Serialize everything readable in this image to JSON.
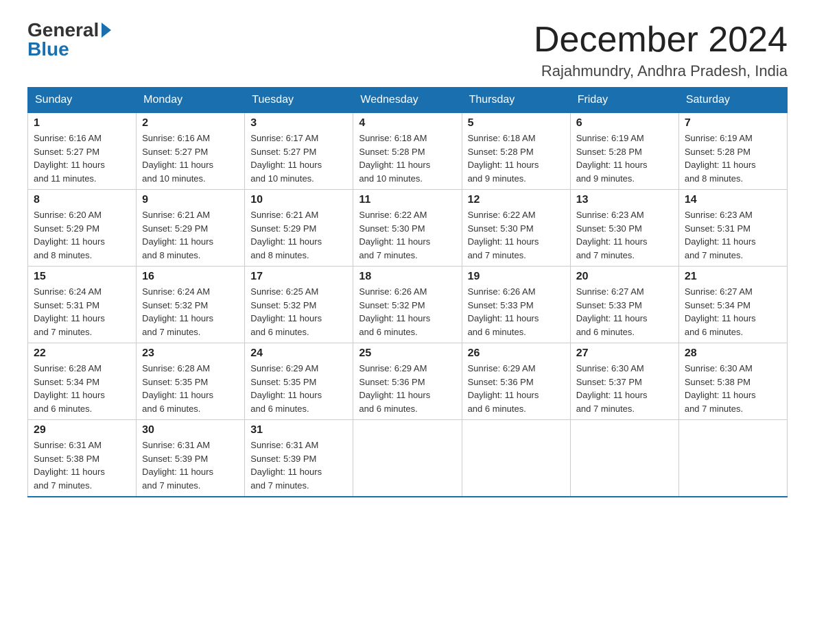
{
  "header": {
    "logo_general": "General",
    "logo_blue": "Blue",
    "title": "December 2024",
    "location": "Rajahmundry, Andhra Pradesh, India"
  },
  "days_of_week": [
    "Sunday",
    "Monday",
    "Tuesday",
    "Wednesday",
    "Thursday",
    "Friday",
    "Saturday"
  ],
  "weeks": [
    [
      {
        "day": "1",
        "sunrise": "6:16 AM",
        "sunset": "5:27 PM",
        "daylight": "11 hours and 11 minutes."
      },
      {
        "day": "2",
        "sunrise": "6:16 AM",
        "sunset": "5:27 PM",
        "daylight": "11 hours and 10 minutes."
      },
      {
        "day": "3",
        "sunrise": "6:17 AM",
        "sunset": "5:27 PM",
        "daylight": "11 hours and 10 minutes."
      },
      {
        "day": "4",
        "sunrise": "6:18 AM",
        "sunset": "5:28 PM",
        "daylight": "11 hours and 10 minutes."
      },
      {
        "day": "5",
        "sunrise": "6:18 AM",
        "sunset": "5:28 PM",
        "daylight": "11 hours and 9 minutes."
      },
      {
        "day": "6",
        "sunrise": "6:19 AM",
        "sunset": "5:28 PM",
        "daylight": "11 hours and 9 minutes."
      },
      {
        "day": "7",
        "sunrise": "6:19 AM",
        "sunset": "5:28 PM",
        "daylight": "11 hours and 8 minutes."
      }
    ],
    [
      {
        "day": "8",
        "sunrise": "6:20 AM",
        "sunset": "5:29 PM",
        "daylight": "11 hours and 8 minutes."
      },
      {
        "day": "9",
        "sunrise": "6:21 AM",
        "sunset": "5:29 PM",
        "daylight": "11 hours and 8 minutes."
      },
      {
        "day": "10",
        "sunrise": "6:21 AM",
        "sunset": "5:29 PM",
        "daylight": "11 hours and 8 minutes."
      },
      {
        "day": "11",
        "sunrise": "6:22 AM",
        "sunset": "5:30 PM",
        "daylight": "11 hours and 7 minutes."
      },
      {
        "day": "12",
        "sunrise": "6:22 AM",
        "sunset": "5:30 PM",
        "daylight": "11 hours and 7 minutes."
      },
      {
        "day": "13",
        "sunrise": "6:23 AM",
        "sunset": "5:30 PM",
        "daylight": "11 hours and 7 minutes."
      },
      {
        "day": "14",
        "sunrise": "6:23 AM",
        "sunset": "5:31 PM",
        "daylight": "11 hours and 7 minutes."
      }
    ],
    [
      {
        "day": "15",
        "sunrise": "6:24 AM",
        "sunset": "5:31 PM",
        "daylight": "11 hours and 7 minutes."
      },
      {
        "day": "16",
        "sunrise": "6:24 AM",
        "sunset": "5:32 PM",
        "daylight": "11 hours and 7 minutes."
      },
      {
        "day": "17",
        "sunrise": "6:25 AM",
        "sunset": "5:32 PM",
        "daylight": "11 hours and 6 minutes."
      },
      {
        "day": "18",
        "sunrise": "6:26 AM",
        "sunset": "5:32 PM",
        "daylight": "11 hours and 6 minutes."
      },
      {
        "day": "19",
        "sunrise": "6:26 AM",
        "sunset": "5:33 PM",
        "daylight": "11 hours and 6 minutes."
      },
      {
        "day": "20",
        "sunrise": "6:27 AM",
        "sunset": "5:33 PM",
        "daylight": "11 hours and 6 minutes."
      },
      {
        "day": "21",
        "sunrise": "6:27 AM",
        "sunset": "5:34 PM",
        "daylight": "11 hours and 6 minutes."
      }
    ],
    [
      {
        "day": "22",
        "sunrise": "6:28 AM",
        "sunset": "5:34 PM",
        "daylight": "11 hours and 6 minutes."
      },
      {
        "day": "23",
        "sunrise": "6:28 AM",
        "sunset": "5:35 PM",
        "daylight": "11 hours and 6 minutes."
      },
      {
        "day": "24",
        "sunrise": "6:29 AM",
        "sunset": "5:35 PM",
        "daylight": "11 hours and 6 minutes."
      },
      {
        "day": "25",
        "sunrise": "6:29 AM",
        "sunset": "5:36 PM",
        "daylight": "11 hours and 6 minutes."
      },
      {
        "day": "26",
        "sunrise": "6:29 AM",
        "sunset": "5:36 PM",
        "daylight": "11 hours and 6 minutes."
      },
      {
        "day": "27",
        "sunrise": "6:30 AM",
        "sunset": "5:37 PM",
        "daylight": "11 hours and 7 minutes."
      },
      {
        "day": "28",
        "sunrise": "6:30 AM",
        "sunset": "5:38 PM",
        "daylight": "11 hours and 7 minutes."
      }
    ],
    [
      {
        "day": "29",
        "sunrise": "6:31 AM",
        "sunset": "5:38 PM",
        "daylight": "11 hours and 7 minutes."
      },
      {
        "day": "30",
        "sunrise": "6:31 AM",
        "sunset": "5:39 PM",
        "daylight": "11 hours and 7 minutes."
      },
      {
        "day": "31",
        "sunrise": "6:31 AM",
        "sunset": "5:39 PM",
        "daylight": "11 hours and 7 minutes."
      },
      null,
      null,
      null,
      null
    ]
  ],
  "labels": {
    "sunrise": "Sunrise:",
    "sunset": "Sunset:",
    "daylight": "Daylight:"
  }
}
